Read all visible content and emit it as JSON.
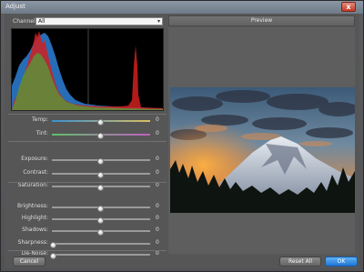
{
  "window": {
    "title": "Adjust",
    "close_glyph": "x"
  },
  "channels": {
    "label": "Channels",
    "selected": "All",
    "arrow": "▾"
  },
  "preview": {
    "title": "Preview"
  },
  "sliders": [
    {
      "name": "temp",
      "label": "Temp:",
      "value": "0",
      "position": 0.5,
      "track": "temp"
    },
    {
      "name": "tint",
      "label": "Tint:",
      "value": "0",
      "position": 0.5,
      "track": "tint"
    },
    {
      "name": "exposure",
      "label": "Exposure:",
      "value": "0",
      "position": 0.5,
      "track": "plain"
    },
    {
      "name": "contrast",
      "label": "Contrast:",
      "value": "0",
      "position": 0.5,
      "track": "plain"
    },
    {
      "name": "saturation",
      "label": "Saturation:",
      "value": "0",
      "position": 0.5,
      "track": "plain"
    },
    {
      "name": "brightness",
      "label": "Brightness:",
      "value": "0",
      "position": 0.5,
      "track": "plain"
    },
    {
      "name": "highlight",
      "label": "Highlight:",
      "value": "0",
      "position": 0.5,
      "track": "plain"
    },
    {
      "name": "shadows",
      "label": "Shadows:",
      "value": "0",
      "position": 0.5,
      "track": "plain"
    },
    {
      "name": "sharpness",
      "label": "Sharpness:",
      "value": "0",
      "position": 0.0,
      "track": "plain"
    },
    {
      "name": "de-noise",
      "label": "De-Noise:",
      "value": "0",
      "position": 0.0,
      "track": "plain"
    }
  ],
  "buttons": {
    "cancel": "Cancel",
    "reset_all": "Reset All",
    "ok": "OK"
  },
  "colors": {
    "accent": "#2f8be6",
    "temp_track_left": "#3b8fd0",
    "temp_track_right": "#d8c060",
    "tint_track_left": "#5fbf6a",
    "tint_track_right": "#c060c0"
  }
}
